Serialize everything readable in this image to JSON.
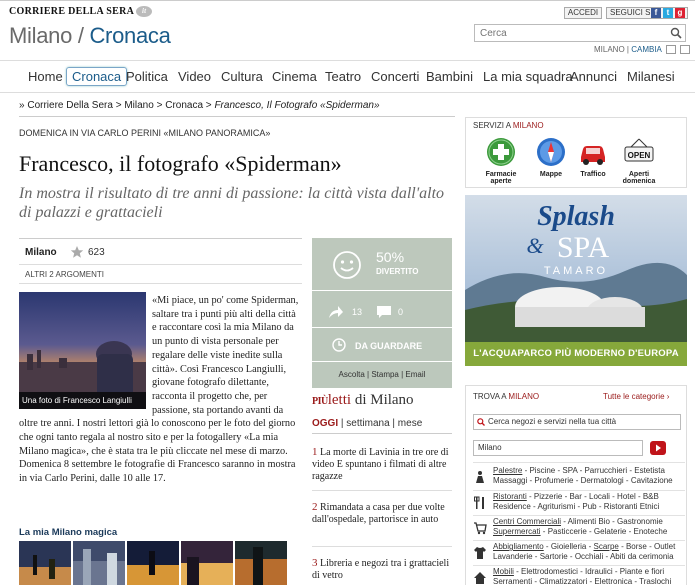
{
  "header": {
    "logo": "CORRIERE DELLA SERA",
    "logo_badge": "it",
    "city": "Milano",
    "separator": " / ",
    "section": "Cronaca",
    "login": "ACCEDI",
    "follow": "SEGUICI SU",
    "search_placeholder": "Cerca",
    "city_current": "MILANO",
    "city_sep": " | ",
    "change_city": "CAMBIA"
  },
  "nav": [
    "Home",
    "Cronaca",
    "Politica",
    "Video",
    "Cultura",
    "Cinema",
    "Teatro",
    "Concerti",
    "Bambini",
    "La mia squadra",
    "Annunci",
    "Milanesi"
  ],
  "breadcrumb": {
    "prefix": "» ",
    "items": [
      "Corriere Della Sera",
      "Milano",
      "Cronaca"
    ],
    "sep": " > ",
    "current": "Francesco, Il Fotografo «Spiderman»"
  },
  "article": {
    "kicker": "DOMENICA IN VIA CARLO PERINI «MILANO PANORAMICA»",
    "title": "Francesco, il fotografo «Spiderman»",
    "subtitle": "In mostra il risultato di tre anni di passione: la città vista dall'alto di palazzi e grattacieli",
    "meta_city": "Milano",
    "meta_count": "623",
    "related": "ALTRI 2 ARGOMENTI",
    "photo_caption": "Una foto di Francesco Langiulli",
    "body": "«Mi piace, un po' come Spiderman, saltare tra i punti più alti della città e raccontare così la mia Milano da un punto di vista personale per regalare delle viste inedite sulla città». Così Francesco Langiulli, giovane fotografo dilettante, racconta il progetto che, per passione, sta portando avanti da oltre tre anni. I nostri lettori già lo conoscono per le foto del giorno che ogni tanto regala al nostro sito e per la fotogallery «La mia Milano magica», che è stata tra le più cliccate nel mese di marzo. Domenica 8 settembre le fotografie di Francesco saranno in mostra in via Carlo Perini, dalle 10 alle 17.",
    "gallery_title": "La mia Milano magica"
  },
  "mood": {
    "percent": "50%",
    "label": "DIVERTITO",
    "shares": "13",
    "comments": "0",
    "watch_label": "DA GUARDARE",
    "actions": [
      "Ascolta",
      "Stampa",
      "Email"
    ],
    "action_sep": " | "
  },
  "piu_letti": {
    "prefix": "PIÙ",
    "title": "letti",
    "city": " di Milano",
    "tabs": [
      "OGGI",
      "settimana",
      "mese"
    ],
    "tab_sep": " | ",
    "items": [
      {
        "num": "1",
        "text": "La morte di Lavinia in tre ore di video E spuntano i filmati di altre ragazze"
      },
      {
        "num": "2",
        "text": "Rimandata a casa per due volte dall'ospedale, partorisce in auto"
      },
      {
        "num": "3",
        "text": "Libreria e negozi tra i grattacieli di vetro"
      }
    ]
  },
  "services": {
    "title_pre": "SERVIZI A ",
    "title_city": "MILANO",
    "items": [
      "Farmacie aperte",
      "Mappe",
      "Traffico",
      "Aperti domenica"
    ],
    "open_sign": "OPEN"
  },
  "ad": {
    "line1": "Splash",
    "amp": "&",
    "line2": "SPA",
    "line3": "TAMARO",
    "footer": "L'ACQUAPARCO PIÙ MODERNO D'EUROPA"
  },
  "trova": {
    "title_pre": "TROVA A ",
    "title_city": "MILANO",
    "all": "Tutte le categorie ›",
    "query": "Cerca negozi e servizi nella tua città",
    "city": "Milano",
    "categories": [
      {
        "first": "Palestre",
        "rest": " - Piscine - SPA - Parrucchieri - Estetista Massaggi - Profumerie - Dermatologi - Cavitazione"
      },
      {
        "first": "Ristoranti",
        "rest": " - Pizzerie - Bar - Locali - Hotel - B&B Residence - Agriturismi - Pub - Ristoranti Etnici"
      },
      {
        "first": "Centri Commerciali",
        "rest": " - Alimenti Bio - Gastronomie ",
        "u2": "Supermercati",
        "rest2": " - Pasticcerie - Gelaterie - Enoteche"
      },
      {
        "first": "Abbigliamento",
        "rest": " - Gioielleria - ",
        "u2": "Scarpe",
        "rest2": " - Borse - Outlet Lavanderie - Sartorie - Occhiali - Abiti da cerimonia"
      },
      {
        "first": "Mobili",
        "rest": " - Elettrodomestici - Idraulici - Piante e fiori Serramenti - Climatizzatori - Elettronica - Traslochi"
      }
    ]
  },
  "colors": {
    "accent": "#1b5c8a",
    "red": "#9a1a1a",
    "mood_bg": "#bcc8bc",
    "ad_green": "#86a83b"
  }
}
